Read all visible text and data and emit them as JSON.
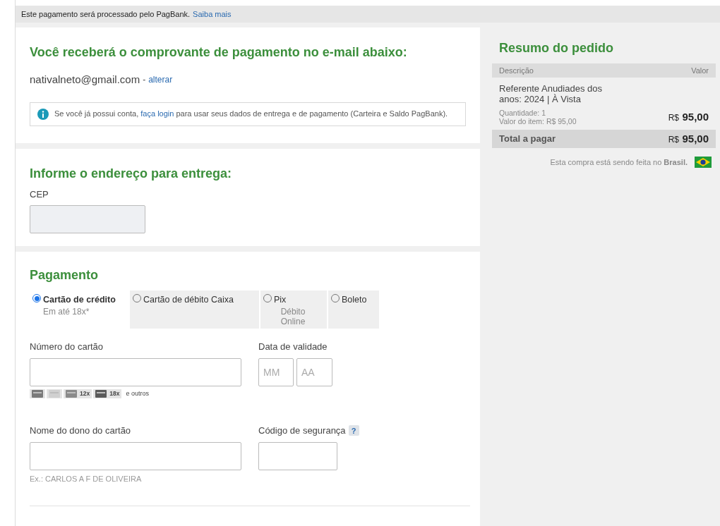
{
  "banner": {
    "text": "Este pagamento será processado pelo PagBank.",
    "link": "Saiba mais"
  },
  "email_section": {
    "title": "Você receberá o comprovante de pagamento no e-mail abaixo:",
    "email": "nativalneto@gmail.com",
    "separator": "-",
    "change_link": "alterar",
    "info_before": "Se você já possui conta,",
    "info_link": "faça login",
    "info_after": "para usar seus dados de entrega e de pagamento (Carteira e Saldo PagBank)."
  },
  "address_section": {
    "title": "Informe o endereço para entrega:",
    "cep_label": "CEP"
  },
  "payment": {
    "title": "Pagamento",
    "tabs": [
      {
        "label": "Cartão de crédito",
        "sub": "Em até 18x*",
        "selected": true
      },
      {
        "label": "Cartão de débito Caixa",
        "selected": false
      },
      {
        "label": "Pix",
        "sub": "Débito Online",
        "selected": false
      },
      {
        "label": "Boleto",
        "selected": false
      }
    ],
    "card_number_label": "Número do cartão",
    "brands": [
      {
        "kind": "plain"
      },
      {
        "kind": "plain"
      },
      {
        "kind": "installments",
        "badge": "12x"
      },
      {
        "kind": "installments",
        "badge": "18x"
      }
    ],
    "brands_more": "e outros",
    "expiry_label": "Data de validade",
    "month_placeholder": "MM",
    "year_placeholder": "AA",
    "name_label": "Nome do dono do cartão",
    "name_hint": "Ex.: CARLOS A F DE OLIVEIRA",
    "cvv_label": "Código de segurança",
    "cvv_help": "?"
  },
  "summary": {
    "title": "Resumo do pedido",
    "col_description": "Descrição",
    "col_value": "Valor",
    "item": {
      "name": "Referente Anudiades dos anos: 2024 | À Vista",
      "quantity": "Quantidade: 1",
      "unit_value": "Valor do item: R$ 95,00",
      "currency": "R$",
      "amount": "95,00"
    },
    "total_label": "Total a pagar",
    "total_currency": "R$",
    "total_amount": "95,00",
    "country_before": "Esta compra está sendo feita no",
    "country": "Brasil."
  }
}
